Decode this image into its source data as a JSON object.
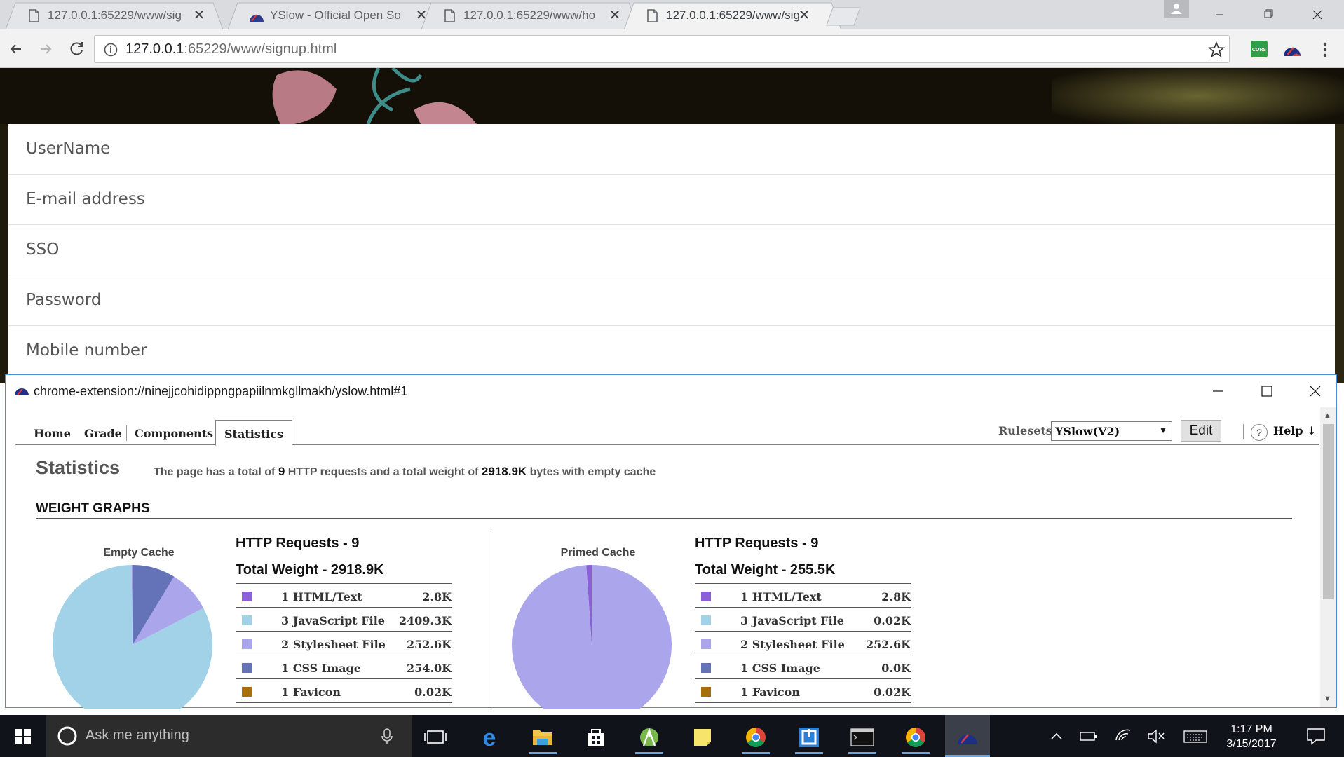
{
  "browser": {
    "tabs": [
      {
        "title": "127.0.0.1:65229/www/sig",
        "favicon": "page-icon",
        "active": false
      },
      {
        "title": "YSlow - Official Open So",
        "favicon": "yslow-icon",
        "active": false
      },
      {
        "title": "127.0.0.1:65229/www/ho",
        "favicon": "page-icon",
        "active": false
      },
      {
        "title": "127.0.0.1:65229/www/sig",
        "favicon": "page-icon",
        "active": true
      }
    ],
    "url_host": "127.0.0.1",
    "url_rest": ":65229/www/signup.html",
    "extensions": [
      "cors-extension-icon",
      "yslow-extension-icon"
    ]
  },
  "signup_form": {
    "fields": [
      {
        "placeholder": "UserName"
      },
      {
        "placeholder": "E-mail address"
      },
      {
        "placeholder": "SSO"
      },
      {
        "placeholder": "Password"
      },
      {
        "placeholder": "Mobile number"
      }
    ]
  },
  "popup": {
    "title": "chrome-extension://ninejjcohidippngpapiilnmkgllmakh/yslow.html#1",
    "tabs": [
      {
        "label": "Home",
        "active": false
      },
      {
        "label": "Grade",
        "active": false
      },
      {
        "label": "Components",
        "active": false
      },
      {
        "label": "Statistics",
        "active": true
      }
    ],
    "rulesets_label": "Rulesets",
    "ruleset_value": "YSlow(V2)",
    "edit_label": "Edit",
    "help_label": "Help ↓",
    "stats_heading": "Statistics",
    "summary": {
      "prefix": "The page has a total of",
      "requests": "9",
      "middle": "HTTP requests and a total weight of",
      "weight": "2918.9K",
      "suffix": "bytes with empty cache"
    },
    "weight_heading": "WEIGHT GRAPHS"
  },
  "chart_data": [
    {
      "type": "pie",
      "title": "Empty Cache",
      "http_requests": "HTTP Requests - 9",
      "total_weight": "Total Weight - 2918.9K",
      "rows": [
        {
          "count": "1",
          "label": "HTML/Text",
          "size": "2.8K",
          "value_k": 2.8,
          "color": "#8a5fd8"
        },
        {
          "count": "3",
          "label": "JavaScript File",
          "size": "2409.3K",
          "value_k": 2409.3,
          "color": "#a2d2e8"
        },
        {
          "count": "2",
          "label": "Stylesheet File",
          "size": "252.6K",
          "value_k": 252.6,
          "color": "#aba6ec"
        },
        {
          "count": "1",
          "label": "CSS Image",
          "size": "254.0K",
          "value_k": 254.0,
          "color": "#6473b8"
        },
        {
          "count": "1",
          "label": "Favicon",
          "size": "0.02K",
          "value_k": 0.02,
          "color": "#a86e0c"
        }
      ]
    },
    {
      "type": "pie",
      "title": "Primed Cache",
      "http_requests": "HTTP Requests - 9",
      "total_weight": "Total Weight - 255.5K",
      "rows": [
        {
          "count": "1",
          "label": "HTML/Text",
          "size": "2.8K",
          "value_k": 2.8,
          "color": "#8a5fd8"
        },
        {
          "count": "3",
          "label": "JavaScript File",
          "size": "0.02K",
          "value_k": 0.02,
          "color": "#a2d2e8"
        },
        {
          "count": "2",
          "label": "Stylesheet File",
          "size": "252.6K",
          "value_k": 252.6,
          "color": "#aba6ec"
        },
        {
          "count": "1",
          "label": "CSS Image",
          "size": "0.0K",
          "value_k": 0.0,
          "color": "#6473b8"
        },
        {
          "count": "1",
          "label": "Favicon",
          "size": "0.02K",
          "value_k": 0.02,
          "color": "#a86e0c"
        }
      ]
    }
  ],
  "taskbar": {
    "search_placeholder": "Ask me anything",
    "time": "1:17 PM",
    "date": "3/15/2017",
    "apps": [
      "task-view-icon",
      "edge-icon",
      "file-explorer-icon",
      "store-icon",
      "android-studio-icon",
      "sticky-notes-icon",
      "chrome-icon",
      "app-icon",
      "terminal-icon",
      "chrome-icon",
      "yslow-icon"
    ]
  }
}
